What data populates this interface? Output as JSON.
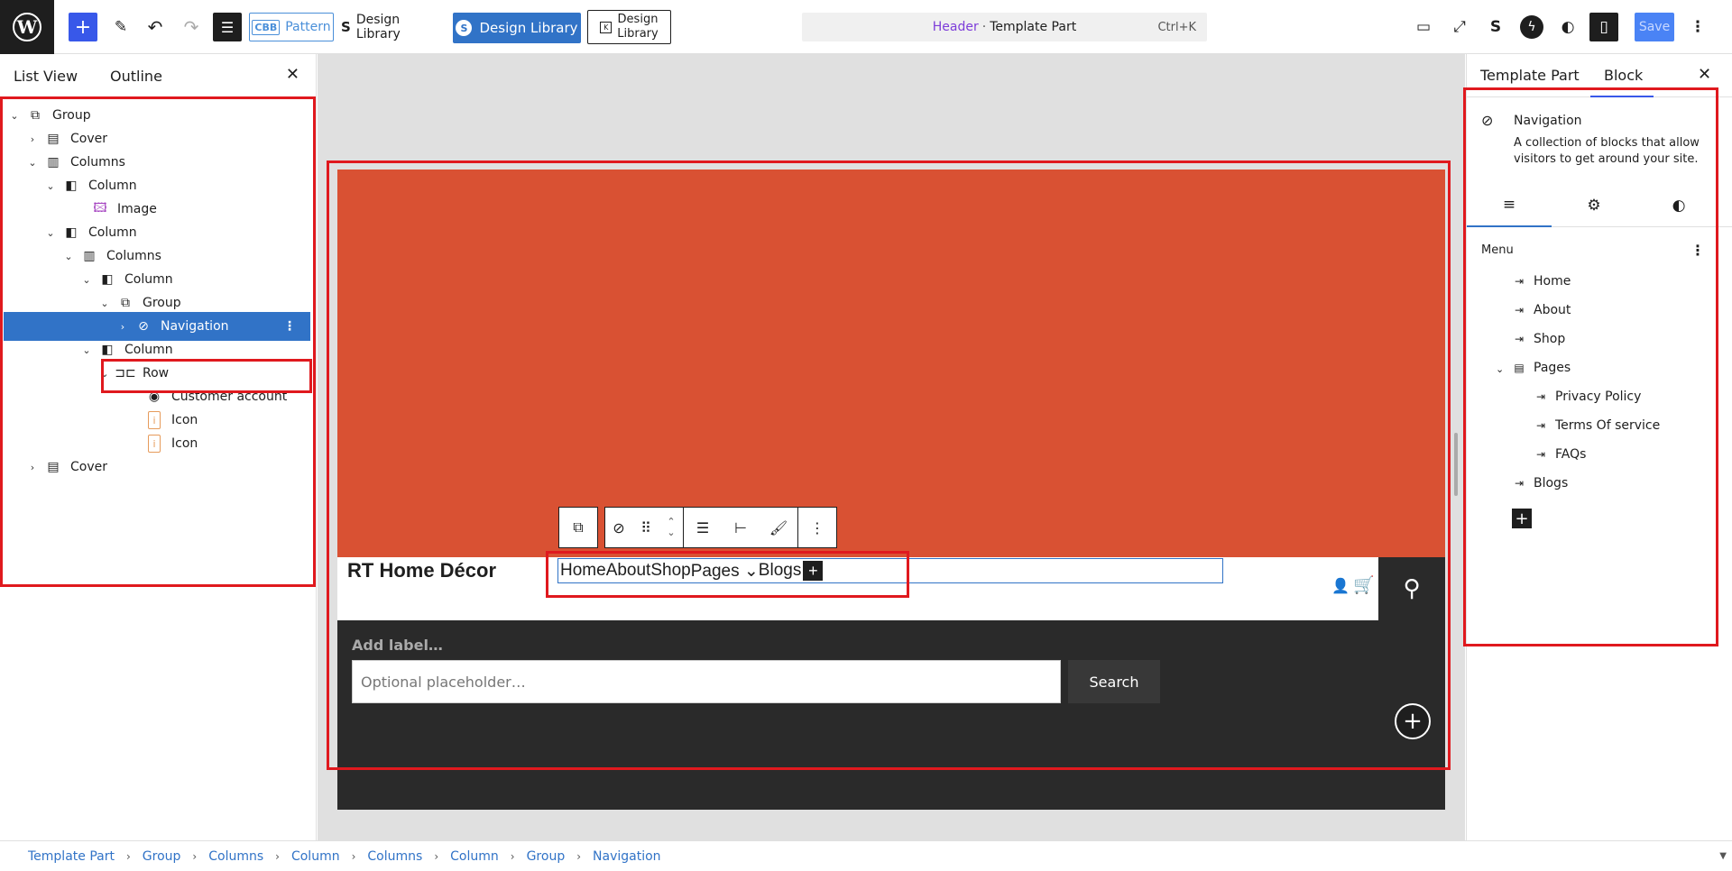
{
  "topbar": {
    "logo_letter": "W",
    "add_label": "+",
    "pattern_prefix": "CBB",
    "pattern_label": "Pattern",
    "design_library_1": "Design Library",
    "design_library_2": "Design Library",
    "design_library_3_line1": "Design",
    "design_library_3_line2": "Library",
    "command": {
      "part": "Header",
      "separator": "·",
      "kind": "Template Part",
      "shortcut": "Ctrl+K"
    },
    "save_label": "Save"
  },
  "left_panel": {
    "tabs": [
      "List View",
      "Outline"
    ],
    "tree": [
      {
        "label": "Group",
        "icon": "group-icon",
        "expanded": true
      },
      {
        "label": "Cover",
        "icon": "cover-icon",
        "expanded": false
      },
      {
        "label": "Columns",
        "icon": "columns-icon",
        "expanded": true
      },
      {
        "label": "Column",
        "icon": "column-icon",
        "expanded": true
      },
      {
        "label": "Image",
        "icon": "image-icon"
      },
      {
        "label": "Column",
        "icon": "column-icon",
        "expanded": true
      },
      {
        "label": "Columns",
        "icon": "columns-icon",
        "expanded": true
      },
      {
        "label": "Column",
        "icon": "column-icon",
        "expanded": true
      },
      {
        "label": "Group",
        "icon": "group-icon",
        "expanded": true
      },
      {
        "label": "Navigation",
        "icon": "navigation-icon",
        "expanded": false,
        "selected": true
      },
      {
        "label": "Column",
        "icon": "column-icon",
        "expanded": true
      },
      {
        "label": "Row",
        "icon": "row-icon",
        "expanded": true
      },
      {
        "label": "Customer account",
        "icon": "customer-account-icon"
      },
      {
        "label": "Icon",
        "icon": "icon-block-icon"
      },
      {
        "label": "Icon",
        "icon": "icon-block-icon"
      },
      {
        "label": "Cover",
        "icon": "cover-icon",
        "expanded": false
      }
    ]
  },
  "canvas": {
    "site_title": "RT Home Décor",
    "nav_items": [
      "Home",
      "About",
      "Shop",
      "Pages ⌄",
      "Blogs"
    ],
    "search_label": "Add label…",
    "search_placeholder": "Optional placeholder…",
    "search_button": "Search",
    "hero_color": "#d95133"
  },
  "right_panel": {
    "tabs": [
      "Template Part",
      "Block"
    ],
    "block_name": "Navigation",
    "block_description": "A collection of blocks that allow visitors to get around your site.",
    "menu_label": "Menu",
    "menu_items": [
      "Home",
      "About",
      "Shop",
      "Pages",
      "Privacy Policy",
      "Terms Of service",
      "FAQs",
      "Blogs"
    ]
  },
  "breadcrumb": [
    "Template Part",
    "Group",
    "Columns",
    "Column",
    "Columns",
    "Column",
    "Group",
    "Navigation"
  ],
  "colors": {
    "accent": "#3858e9",
    "selection": "#3173c7",
    "highlight": "#e0191e",
    "hero": "#d95133",
    "dark": "#2a2a2a"
  }
}
